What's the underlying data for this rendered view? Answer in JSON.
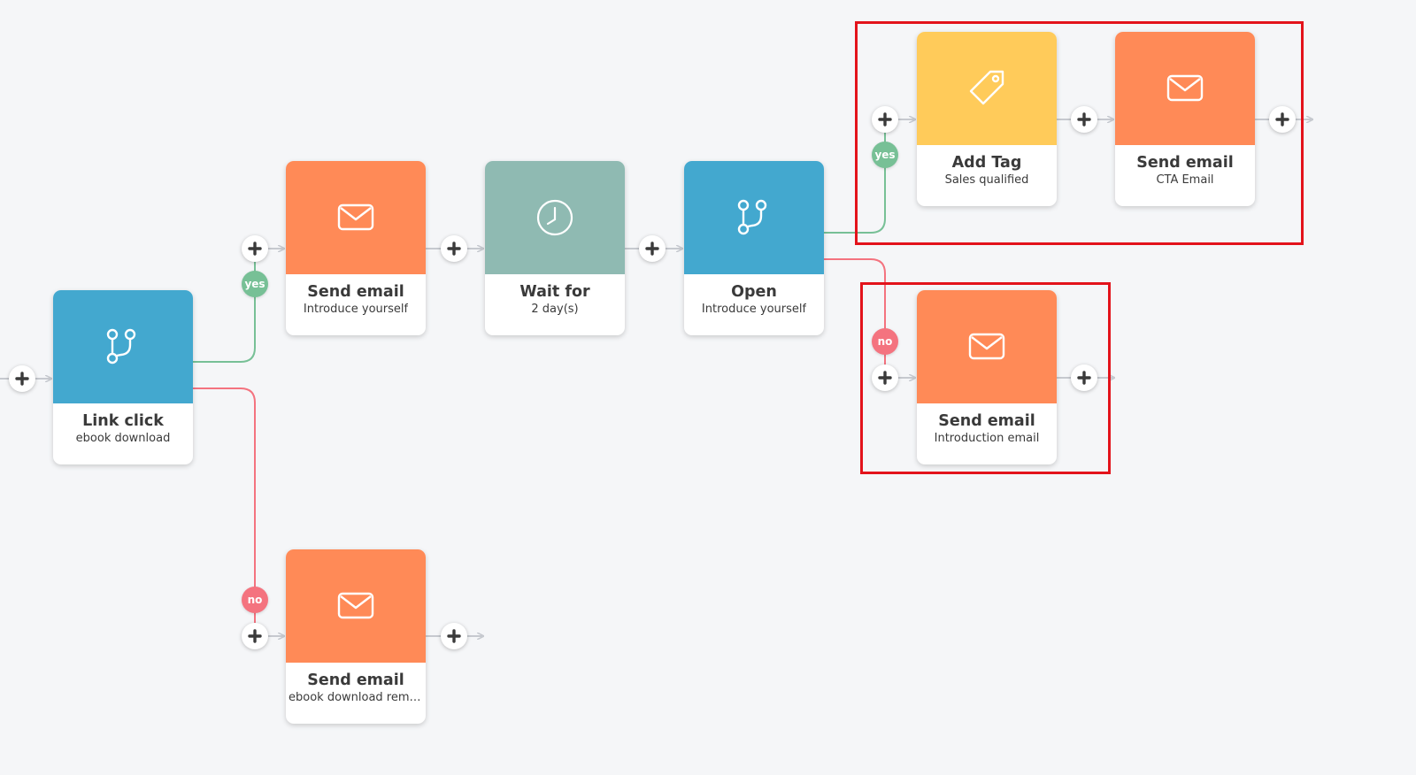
{
  "colors": {
    "background": "#f5f6f8",
    "email": "#ff8a57",
    "condition": "#43a8cf",
    "wait": "#8fbab2",
    "tag": "#ffcb5a",
    "yes": "#77c096",
    "no": "#f4737f",
    "connector": "#c6c9cf",
    "highlight": "#e3131b"
  },
  "nodes": [
    {
      "id": "link-click",
      "type": "condition",
      "icon": "branch-icon",
      "title": "Link click",
      "subtitle": "ebook download"
    },
    {
      "id": "send-email-introduce",
      "type": "email",
      "icon": "envelope-icon",
      "title": "Send email",
      "subtitle": "Introduce yourself"
    },
    {
      "id": "wait-for",
      "type": "wait",
      "icon": "clock-icon",
      "title": "Wait for",
      "subtitle": "2 day(s)"
    },
    {
      "id": "open",
      "type": "condition",
      "icon": "branch-icon",
      "title": "Open",
      "subtitle": "Introduce yourself"
    },
    {
      "id": "add-tag",
      "type": "tag",
      "icon": "tag-icon",
      "title": "Add Tag",
      "subtitle": "Sales qualified"
    },
    {
      "id": "send-email-cta",
      "type": "email",
      "icon": "envelope-icon",
      "title": "Send email",
      "subtitle": "CTA Email"
    },
    {
      "id": "send-email-introduction",
      "type": "email",
      "icon": "envelope-icon",
      "title": "Send email",
      "subtitle": "Introduction email"
    },
    {
      "id": "send-email-reminder",
      "type": "email",
      "icon": "envelope-icon",
      "title": "Send email",
      "subtitle": "ebook download remin..."
    }
  ],
  "branches": {
    "yes_label": "yes",
    "no_label": "no"
  },
  "add_step": {
    "icon": "plus-icon"
  }
}
